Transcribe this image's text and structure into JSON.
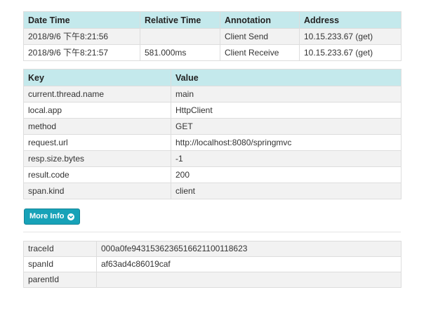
{
  "annotations": {
    "headers": [
      "Date Time",
      "Relative Time",
      "Annotation",
      "Address"
    ],
    "rows": [
      [
        "2018/9/6 下午8:21:56",
        "",
        "Client Send",
        "10.15.233.67 (get)"
      ],
      [
        "2018/9/6 下午8:21:57",
        "581.000ms",
        "Client Receive",
        "10.15.233.67 (get)"
      ]
    ]
  },
  "tags": {
    "headers": [
      "Key",
      "Value"
    ],
    "rows": [
      [
        "current.thread.name",
        "main"
      ],
      [
        "local.app",
        "HttpClient"
      ],
      [
        "method",
        "GET"
      ],
      [
        "request.url",
        "http://localhost:8080/springmvc"
      ],
      [
        "resp.size.bytes",
        "-1"
      ],
      [
        "result.code",
        "200"
      ],
      [
        "span.kind",
        "client"
      ]
    ]
  },
  "more_info": {
    "label": "More Info",
    "icon": "chevron-down-circle-icon",
    "color": "#17a2b8"
  },
  "ids": {
    "rows": [
      [
        "traceId",
        "000a0fe9431536236516621100118623"
      ],
      [
        "spanId",
        "af63ad4c86019caf"
      ],
      [
        "parentId",
        ""
      ]
    ]
  }
}
